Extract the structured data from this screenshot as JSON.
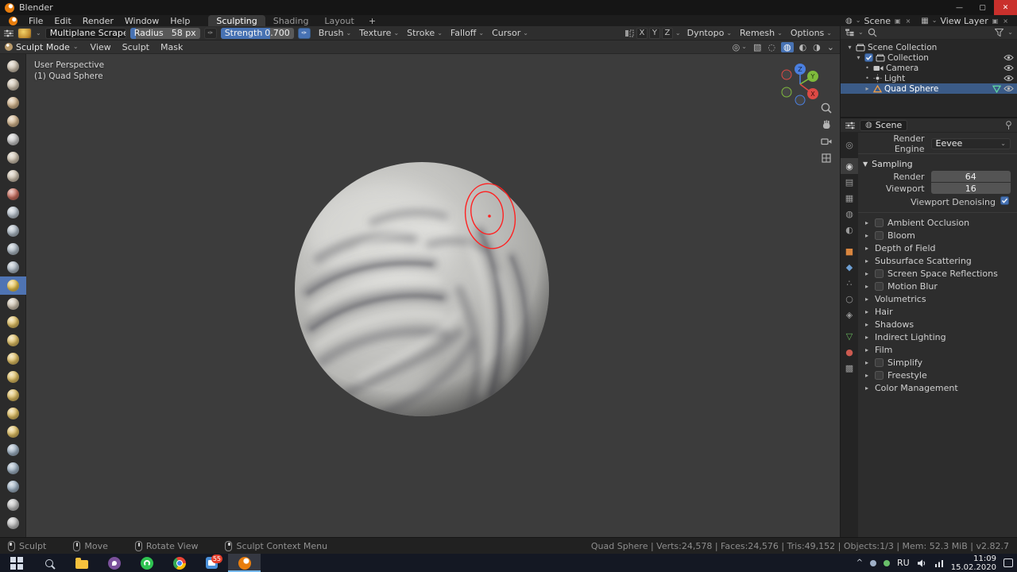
{
  "window": {
    "title": "Blender",
    "controls": {
      "minimize": "—",
      "maximize": "▢",
      "close": "✕"
    }
  },
  "menubar": {
    "menus": [
      "File",
      "Edit",
      "Render",
      "Window",
      "Help"
    ],
    "workspaces": [
      "Sculpting",
      "Shading",
      "Layout"
    ],
    "active_workspace": "Sculpting",
    "add_workspace": "+",
    "scene": {
      "label": "Scene"
    },
    "view_layer": {
      "label": "View Layer"
    }
  },
  "tool_settings": {
    "tool_name": "Multiplane Scrape",
    "radius": {
      "label": "Radius",
      "value": "58 px",
      "fill": 0.08
    },
    "strength": {
      "label": "Strength",
      "value": "0.700",
      "fill": 0.68
    },
    "dropdowns": [
      "Brush",
      "Texture",
      "Stroke",
      "Falloff",
      "Cursor"
    ],
    "mirror_axes": [
      "X",
      "Y",
      "Z"
    ],
    "right_dropdowns": [
      "Dyntopo",
      "Remesh",
      "Options"
    ]
  },
  "viewport": {
    "mode": "Sculpt Mode",
    "menus": [
      "View",
      "Sculpt",
      "Mask"
    ],
    "overlay": [
      "User Perspective",
      "(1) Quad Sphere"
    ],
    "gizmo_axes": [
      "X",
      "Y",
      "Z"
    ],
    "header_icons": [
      {
        "name": "show-gizmo",
        "glyph": "◎",
        "caret": true
      },
      {
        "name": "xray-toggle",
        "glyph": "▧"
      },
      {
        "name": "shading-wireframe",
        "glyph": "◌"
      },
      {
        "name": "shading-solid",
        "glyph": "◍",
        "active": true
      },
      {
        "name": "shading-material",
        "glyph": "◐"
      },
      {
        "name": "shading-rendered",
        "glyph": "◑"
      },
      {
        "name": "shading-options",
        "glyph": "⌄"
      }
    ]
  },
  "toolbar": {
    "tools": [
      {
        "name": "draw",
        "color": "#cfc3b0"
      },
      {
        "name": "draw-sharp",
        "color": "#cfc3b0"
      },
      {
        "name": "clay",
        "color": "#d2b48c"
      },
      {
        "name": "clay-strips",
        "color": "#d2b48c"
      },
      {
        "name": "layer",
        "color": "#c8c8c8"
      },
      {
        "name": "inflate",
        "color": "#cfc3b0"
      },
      {
        "name": "blob",
        "color": "#cfc3b0"
      },
      {
        "name": "crease",
        "color": "#c96f5f"
      },
      {
        "name": "smooth",
        "color": "#b9c3cd"
      },
      {
        "name": "flatten",
        "color": "#adb9c4"
      },
      {
        "name": "fill",
        "color": "#adb9c4"
      },
      {
        "name": "scrape",
        "color": "#adb9c4"
      },
      {
        "name": "multiplane-scrape",
        "color": "#e8c24a",
        "active": true
      },
      {
        "name": "pinch",
        "color": "#cfc3b0"
      },
      {
        "name": "grab",
        "color": "#e0bf62"
      },
      {
        "name": "elastic-deform",
        "color": "#e0bf62"
      },
      {
        "name": "snake-hook",
        "color": "#e0bf62"
      },
      {
        "name": "thumb",
        "color": "#e0bf62"
      },
      {
        "name": "pose",
        "color": "#e0bf62"
      },
      {
        "name": "nudge",
        "color": "#e0bf62"
      },
      {
        "name": "rotate",
        "color": "#e0bf62"
      },
      {
        "name": "slide-relax",
        "color": "#9fb2c4"
      },
      {
        "name": "mask",
        "color": "#9fb2c4"
      },
      {
        "name": "box-mask",
        "color": "#9fb2c4"
      },
      {
        "name": "annotate",
        "color": "#c0c0c0"
      },
      {
        "name": "measure",
        "color": "#c0c0c0"
      }
    ]
  },
  "outliner": {
    "rows": [
      {
        "label": "Scene Collection",
        "icon": "collection",
        "depth": 0,
        "disclosure": "▾"
      },
      {
        "label": "Collection",
        "icon": "collection",
        "depth": 1,
        "disclosure": "▾",
        "checkbox": true,
        "eye": true
      },
      {
        "label": "Camera",
        "icon": "camera",
        "depth": 2,
        "bullet": true,
        "eye": true
      },
      {
        "label": "Light",
        "icon": "light",
        "depth": 2,
        "bullet": true,
        "eye": true
      },
      {
        "label": "Quad Sphere",
        "icon": "mesh",
        "depth": 2,
        "disclosure": "▸",
        "data_icon": true,
        "eye": true,
        "selected": true
      }
    ]
  },
  "properties": {
    "breadcrumb": "Scene",
    "render_engine_label": "Render Engine",
    "render_engine_value": "Eevee",
    "sampling": {
      "title": "Sampling",
      "render_label": "Render",
      "render_value": "64",
      "viewport_label": "Viewport",
      "viewport_value": "16",
      "denoise_label": "Viewport Denoising"
    },
    "tabs": [
      {
        "name": "tool",
        "glyph": "◎",
        "color": "#9a9a9a"
      },
      {
        "name": "render",
        "glyph": "◉",
        "color": "#d0d0d0",
        "active": true
      },
      {
        "name": "output",
        "glyph": "▤",
        "color": "#9a9a9a"
      },
      {
        "name": "view-layer",
        "glyph": "▦",
        "color": "#9a9a9a"
      },
      {
        "name": "scene",
        "glyph": "◍",
        "color": "#9a9a9a"
      },
      {
        "name": "world",
        "glyph": "◐",
        "color": "#9a9a9a"
      },
      {
        "name": "object",
        "glyph": "■",
        "color": "#d9863f"
      },
      {
        "name": "modifiers",
        "glyph": "◆",
        "color": "#6d9fd3"
      },
      {
        "name": "particles",
        "glyph": "∴",
        "color": "#9a9a9a"
      },
      {
        "name": "physics",
        "glyph": "○",
        "color": "#9a9a9a"
      },
      {
        "name": "constraints",
        "glyph": "◈",
        "color": "#9a9a9a"
      },
      {
        "name": "object-data",
        "glyph": "▽",
        "color": "#67b65c"
      },
      {
        "name": "material",
        "glyph": "●",
        "color": "#cc5a50"
      },
      {
        "name": "texture",
        "glyph": "▩",
        "color": "#9a9a9a"
      }
    ],
    "sections": [
      {
        "label": "Ambient Occlusion",
        "checkbox": true
      },
      {
        "label": "Bloom",
        "checkbox": true
      },
      {
        "label": "Depth of Field",
        "checkbox": false
      },
      {
        "label": "Subsurface Scattering",
        "checkbox": false
      },
      {
        "label": "Screen Space Reflections",
        "checkbox": true
      },
      {
        "label": "Motion Blur",
        "checkbox": true
      },
      {
        "label": "Volumetrics",
        "checkbox": false
      },
      {
        "label": "Hair",
        "checkbox": false
      },
      {
        "label": "Shadows",
        "checkbox": false
      },
      {
        "label": "Indirect Lighting",
        "checkbox": false
      },
      {
        "label": "Film",
        "checkbox": false
      },
      {
        "label": "Simplify",
        "checkbox": true
      },
      {
        "label": "Freestyle",
        "checkbox": true
      },
      {
        "label": "Color Management",
        "checkbox": false
      }
    ]
  },
  "statusbar": {
    "left": [
      {
        "label": "Sculpt",
        "button": "lmb"
      },
      {
        "label": "Move",
        "button": "mmb"
      },
      {
        "label": "Rotate View",
        "button": "mmb"
      },
      {
        "label": "Sculpt Context Menu",
        "button": "rmb"
      }
    ],
    "right": "Quad Sphere | Verts:24,578 | Faces:24,576 | Tris:49,152 | Objects:1/3 | Mem: 52.3 MiB | v2.82.7"
  },
  "taskbar": {
    "apps": [
      {
        "name": "start"
      },
      {
        "name": "search"
      },
      {
        "name": "explorer"
      },
      {
        "name": "viber"
      },
      {
        "name": "whatsapp"
      },
      {
        "name": "chrome"
      },
      {
        "name": "wps",
        "badge": "55"
      },
      {
        "name": "blender",
        "active": true
      }
    ],
    "language": "RU",
    "time": "11:09",
    "date": "15.02.2020",
    "tray_expand": "^"
  }
}
